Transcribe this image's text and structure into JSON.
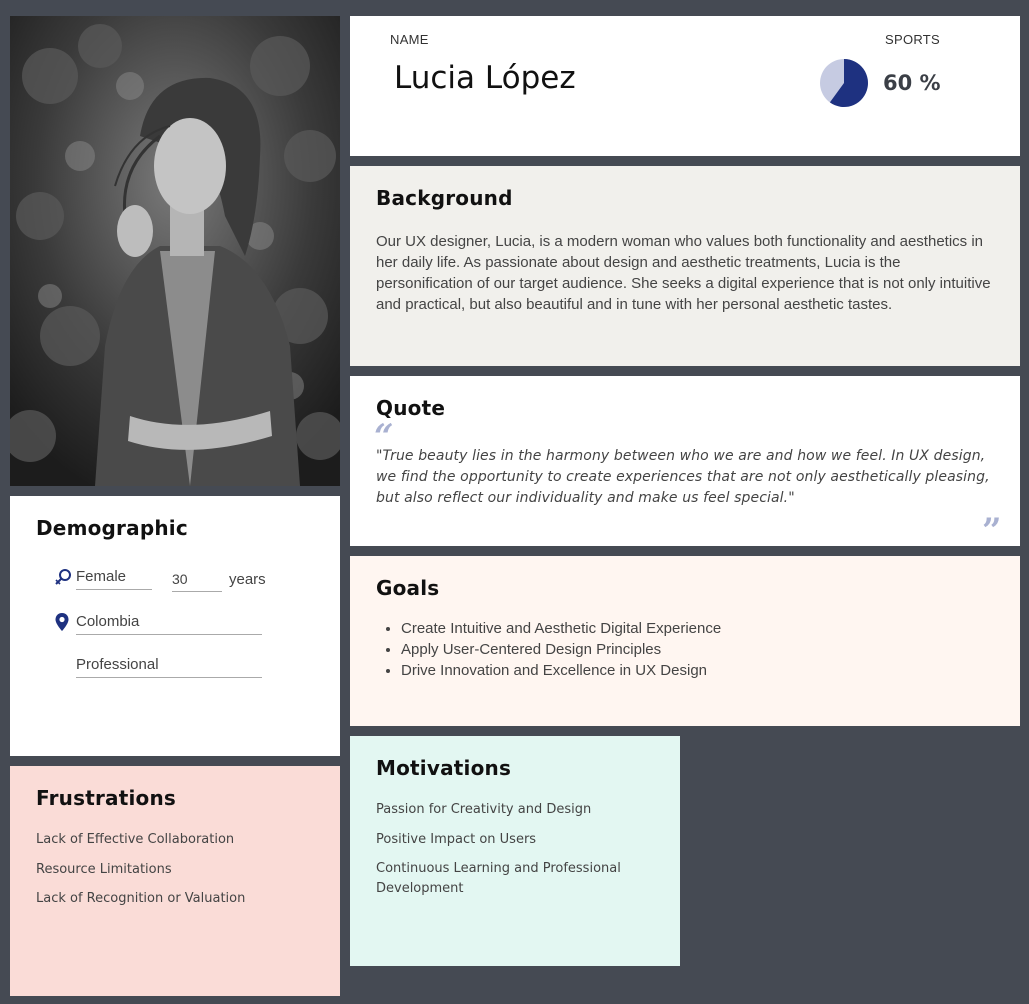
{
  "name_card": {
    "name_caption": "NAME",
    "name_value": "Lucia López",
    "sports_caption": "SPORTS",
    "sports_percent": 60,
    "sports_percent_label": "60 %",
    "pie_colors": {
      "fill": "#1e3180",
      "track": "#c6cbe2"
    }
  },
  "background": {
    "title": "Background",
    "text": "Our UX designer, Lucia, is a modern woman who values both functionality and aesthetics in her daily life. As passionate about design and aesthetic treatments, Lucia is the personification of our target audience. She seeks a digital experience that is not only intuitive and practical, but also beautiful and in tune with her personal aesthetic tastes."
  },
  "quote": {
    "title": "Quote",
    "open_mark": "“",
    "close_mark": "”",
    "text": "\"True beauty lies in the harmony between who we are and how we feel. In UX design, we find the opportunity to create experiences that are not only aesthetically pleasing, but also reflect our individuality and make us feel special.\""
  },
  "goals": {
    "title": "Goals",
    "items": [
      "Create Intuitive and Aesthetic Digital Experience",
      "Apply User-Centered Design Principles",
      "Drive Innovation and Excellence in UX Design"
    ]
  },
  "demographic": {
    "title": "Demographic",
    "gender": "Female",
    "age": "30",
    "age_unit": "years",
    "location": "Colombia",
    "occupation": "Professional",
    "icons": {
      "gender": "gender-icon",
      "location": "location-pin-icon"
    },
    "accent": "#1e3180"
  },
  "frustrations": {
    "title": "Frustrations",
    "items": [
      "Lack of Effective Collaboration",
      "Resource Limitations",
      "Lack of Recognition or Valuation"
    ]
  },
  "motivations": {
    "title": "Motivations",
    "items": [
      "Passion for Creativity and Design",
      "Positive Impact on Users",
      "Continuous Learning and Professional Development"
    ]
  }
}
